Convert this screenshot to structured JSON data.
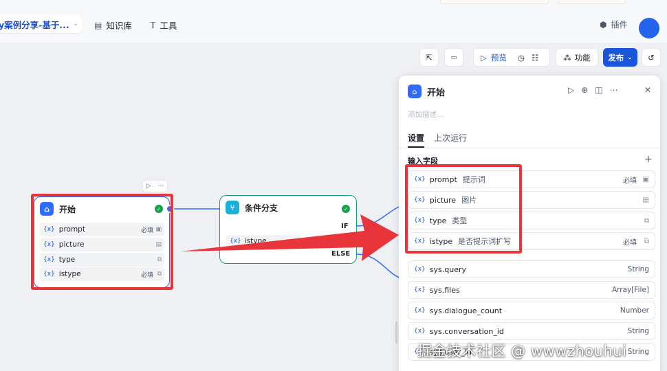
{
  "header": {
    "app_name": "y案例分享-基于...",
    "nav": [
      {
        "label": "知识库",
        "icon": "book-icon"
      },
      {
        "label": "工具",
        "icon": "tool-icon"
      }
    ],
    "plugin_label": "插件"
  },
  "toolbar": {
    "preview_label": "预览",
    "features_label": "功能",
    "publish_label": "发布"
  },
  "start_node": {
    "title": "开始",
    "rows": [
      {
        "name": "prompt",
        "required": "必填"
      },
      {
        "name": "picture",
        "required": ""
      },
      {
        "name": "type",
        "required": ""
      },
      {
        "name": "istype",
        "required": "必填"
      }
    ]
  },
  "condition_node": {
    "title": "条件分支",
    "if_label": "IF",
    "else_label": "ELSE",
    "chip": "istype"
  },
  "panel": {
    "title": "开始",
    "description_placeholder": "添加描述...",
    "tabs": [
      "设置",
      "上次运行"
    ],
    "input_section": "输入字段",
    "fields": [
      {
        "name": "prompt",
        "desc": "提示词",
        "required": "必填"
      },
      {
        "name": "picture",
        "desc": "图片",
        "required": ""
      },
      {
        "name": "type",
        "desc": "类型",
        "required": ""
      },
      {
        "name": "istype",
        "desc": "是否提示词扩写",
        "required": "必填"
      }
    ],
    "sys_fields": [
      {
        "name": "sys.query",
        "type": "String"
      },
      {
        "name": "sys.files",
        "type": "Array[File]"
      },
      {
        "name": "sys.dialogue_count",
        "type": "Number"
      },
      {
        "name": "sys.conversation_id",
        "type": "String"
      },
      {
        "name": "sys.user_id",
        "type": "String"
      }
    ]
  },
  "watermark": "掘金技术社区 @ wwwzhouhui",
  "colors": {
    "accent": "#2f6bff",
    "primary_button": "#1a56db",
    "success": "#12a150",
    "highlight_red": "#e8343b",
    "condition_border": "#16a37a"
  }
}
